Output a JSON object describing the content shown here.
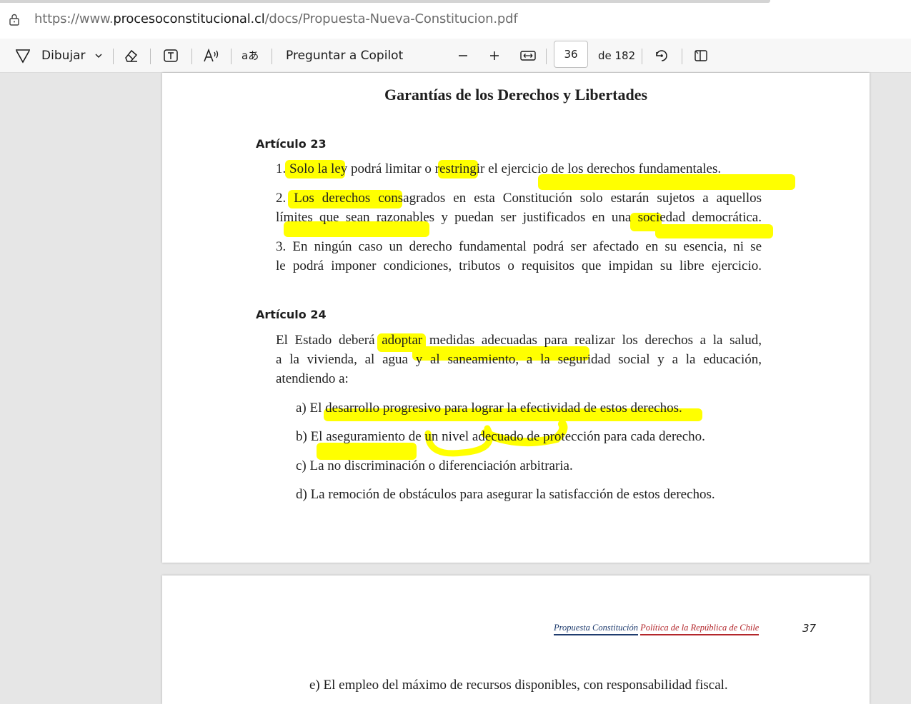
{
  "browser": {
    "url_prefix": "https://www.",
    "url_domain": "procesoconstitucional.cl",
    "url_path": "/docs/Propuesta-Nueva-Constitucion.pdf"
  },
  "toolbar": {
    "draw_label": "Dibujar",
    "copilot_label": "Preguntar a Copilot",
    "current_page": "36",
    "page_total": "de 182",
    "icons": [
      "draw-icon",
      "chevron-down-icon",
      "eraser-icon",
      "text-icon",
      "read-aloud-icon",
      "translate-icon",
      "zoom-out-icon",
      "zoom-in-icon",
      "fit-width-icon",
      "rotate-icon",
      "page-view-icon"
    ]
  },
  "page36": {
    "heading": "Garantías de los Derechos y Libertades",
    "art23": {
      "title": "Artículo 23",
      "p1": "1. Solo la ley podrá limitar o restringir el ejercicio de los derechos fundamentales.",
      "p2_l1": "2. Los derechos consagrados en esta Constitución solo estarán sujetos a aquellos",
      "p2_l2": "límites que sean razonables y puedan ser justificados en una sociedad democrática.",
      "p3_l1": "3. En ningún caso un derecho fundamental podrá ser afectado en su esencia, ni se",
      "p3_l2": "le podrá imponer condiciones, tributos o requisitos que impidan su libre ejercicio."
    },
    "art24": {
      "title": "Artículo 24",
      "intro_l1": "El Estado deberá adoptar medidas adecuadas para realizar los derechos a la salud,",
      "intro_l2": "a la vivienda, al agua y al saneamiento, a la seguridad social y a la educación,",
      "intro_l3": "atendiendo a:",
      "a": "a) El desarrollo progresivo para lograr la efectividad de estos derechos.",
      "b": "b) El aseguramiento de un nivel adecuado de protección para cada derecho.",
      "c": "c) La no discriminación o diferenciación arbitraria.",
      "d": "d) La remoción de obstáculos para asegurar la satisfacción de estos derechos."
    },
    "highlight_color": "#ffff00"
  },
  "page37": {
    "footer_blue": "Propuesta Constitución",
    "footer_red": "Política de la República de Chile",
    "page_number": "37",
    "e": "e) El empleo del máximo de recursos disponibles, con responsabilidad fiscal."
  }
}
